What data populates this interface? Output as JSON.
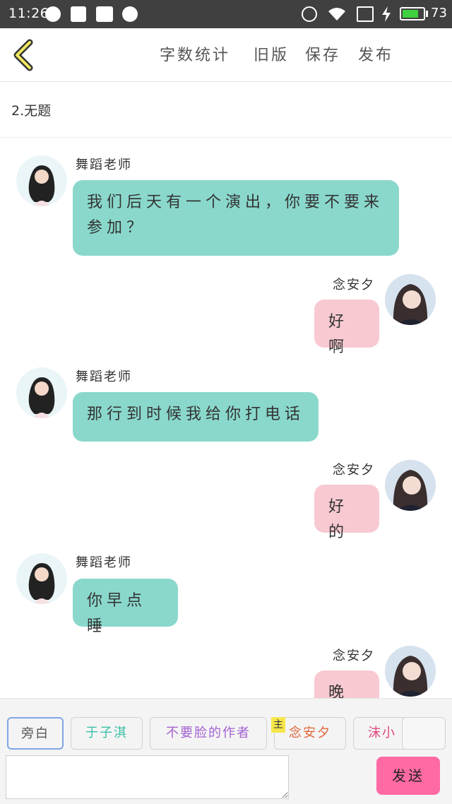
{
  "status_bar": {
    "time": "11:26",
    "battery_level": "73"
  },
  "header": {
    "actions": [
      {
        "label": "字数统计"
      },
      {
        "label": "旧版"
      },
      {
        "label": "保存"
      },
      {
        "label": "发布"
      }
    ]
  },
  "document": {
    "title": "2.无题"
  },
  "messages": [
    {
      "sender": "舞蹈老师",
      "side": "left",
      "text_lines": [
        "我们后天有一个演出，你要不要来",
        "参加？"
      ]
    },
    {
      "sender": "念安夕",
      "side": "right",
      "text_lines": [
        "好啊"
      ]
    },
    {
      "sender": "舞蹈老师",
      "side": "left",
      "text_lines": [
        "那行到时候我给你打电话"
      ]
    },
    {
      "sender": "念安夕",
      "side": "right",
      "text_lines": [
        "好的"
      ]
    },
    {
      "sender": "舞蹈老师",
      "side": "left",
      "text_lines": [
        "你早点睡"
      ]
    },
    {
      "sender": "念安夕",
      "side": "right",
      "text_lines": [
        "晚安"
      ]
    }
  ],
  "role_chips": [
    {
      "label": "旁白",
      "color": "#555555"
    },
    {
      "label": "于子淇",
      "color": "#3cbfa6"
    },
    {
      "label": "不要脸的作者",
      "color": "#a463d1"
    },
    {
      "label": "念安夕",
      "color": "#e0673c"
    },
    {
      "label": "沫小",
      "color": "#e0467f"
    }
  ],
  "host_badge": "主",
  "composer": {
    "value": "",
    "send_label": "发送"
  }
}
